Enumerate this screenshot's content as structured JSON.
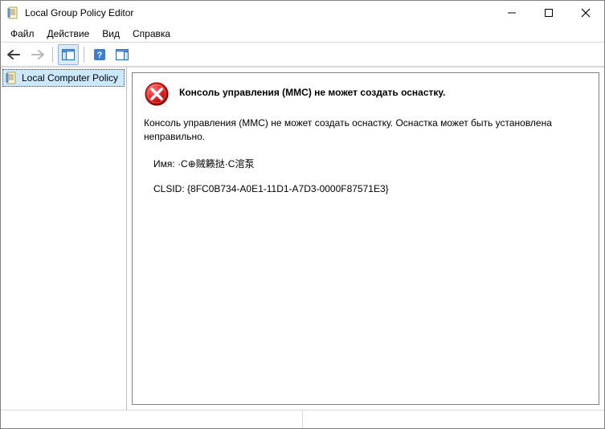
{
  "window": {
    "title": "Local Group Policy Editor"
  },
  "menu": {
    "file": "Файл",
    "action": "Действие",
    "view": "Вид",
    "help": "Справка"
  },
  "tree": {
    "root_label": "Local Computer Policy"
  },
  "error": {
    "title": "Консоль управления (MMC) не может создать оснастку.",
    "body": "Консоль управления (MMC) не может создать оснастку. Оснастка может быть установлена неправильно.",
    "name_label": "Имя:",
    "name_value": "·С⊕贼籁挞·С涫泵",
    "clsid_label": "CLSID:",
    "clsid_value": "{8FC0B734-A0E1-11D1-A7D3-0000F87571E3}"
  }
}
